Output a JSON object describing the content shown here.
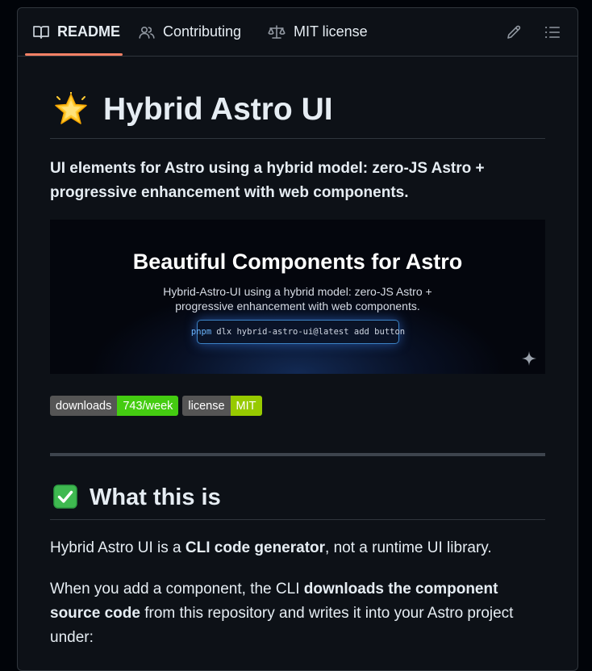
{
  "tabs": [
    {
      "label": "README",
      "icon": "book-icon",
      "active": true
    },
    {
      "label": "Contributing",
      "icon": "people-icon",
      "active": false
    },
    {
      "label": "MIT license",
      "icon": "law-scale-icon",
      "active": false
    }
  ],
  "toolbar": {
    "edit_icon": "pencil-icon",
    "outline_icon": "list-unordered-icon"
  },
  "readme": {
    "title_emoji": "glowing-star-emoji",
    "title": "Hybrid Astro UI",
    "lead": "UI elements for Astro using a hybrid model: zero-JS Astro + progressive enhancement with web components.",
    "banner": {
      "title": "Beautiful Components for Astro",
      "subtitle_line1": "Hybrid-Astro-UI using a hybrid model: zero-JS Astro +",
      "subtitle_line2": "progressive enhancement with web components.",
      "command_prefix": "pnpm",
      "command_rest": "dlx hybrid-astro-ui@latest add button",
      "sparkle_icon": "sparkle-icon"
    },
    "badges": [
      {
        "label": "downloads",
        "value": "743/week",
        "color": "#4c1"
      },
      {
        "label": "license",
        "value": "MIT",
        "color": "#97ca00"
      }
    ],
    "section_heading_emoji": "check-mark-button-emoji",
    "section_heading": "What this is",
    "p1": {
      "before": "Hybrid Astro UI is a ",
      "bold": "CLI code generator",
      "after": ", not a runtime UI library."
    },
    "p2": {
      "before": "When you add a component, the CLI ",
      "bold": "downloads the component source code",
      "after": " from this repository and writes it into your Astro project under:"
    }
  },
  "colors": {
    "background": "#0d1117",
    "border": "#30363d",
    "active_tab_underline": "#f78166",
    "text": "#e6edf3"
  }
}
